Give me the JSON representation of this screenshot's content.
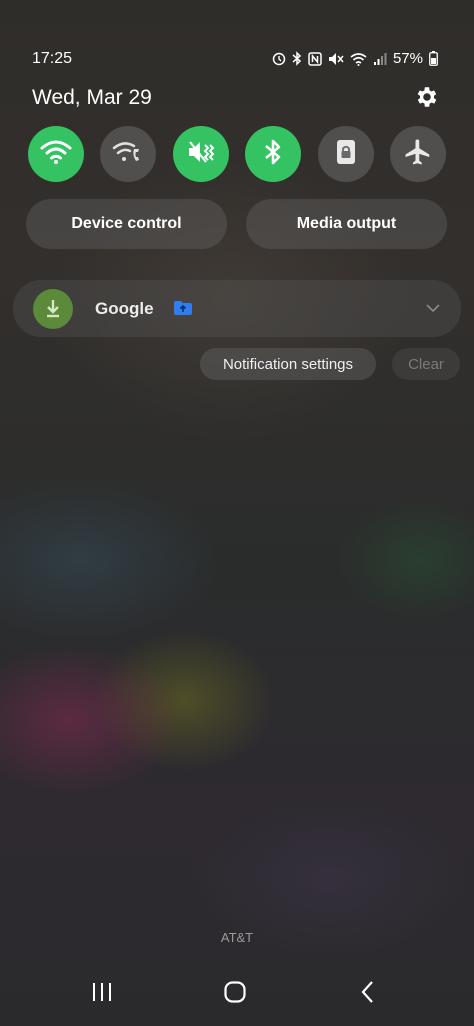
{
  "status_bar": {
    "time": "17:25",
    "battery": "57%",
    "icons": [
      "alarm-icon",
      "bluetooth-icon",
      "nfc-icon",
      "mute-icon",
      "wifi-icon",
      "signal-icon",
      "battery-icon"
    ]
  },
  "header": {
    "date": "Wed, Mar 29",
    "settings_icon": "gear-icon"
  },
  "quick_settings": [
    {
      "name": "wifi",
      "icon": "wifi-icon",
      "state": "on"
    },
    {
      "name": "wifi-calling",
      "icon": "wifi-calling-icon",
      "state": "off"
    },
    {
      "name": "sound",
      "icon": "mute-icon",
      "state": "on"
    },
    {
      "name": "bluetooth",
      "icon": "bluetooth-icon",
      "state": "on"
    },
    {
      "name": "portrait-lock",
      "icon": "lock-icon",
      "state": "off"
    },
    {
      "name": "airplane-mode",
      "icon": "airplane-icon",
      "state": "off"
    }
  ],
  "panel_buttons": {
    "device_control": "Device control",
    "media_output": "Media output"
  },
  "notification": {
    "app_name": "Google",
    "icon": "download-icon",
    "badge_icon": "folder-icon"
  },
  "notification_actions": {
    "settings": "Notification settings",
    "clear": "Clear"
  },
  "carrier": "AT&T",
  "colors": {
    "accent_on": "#34c262",
    "toggle_off": "#5a5a5a",
    "notification_icon_bg": "#5a8a3a",
    "folder_blue": "#2f7ef0"
  }
}
